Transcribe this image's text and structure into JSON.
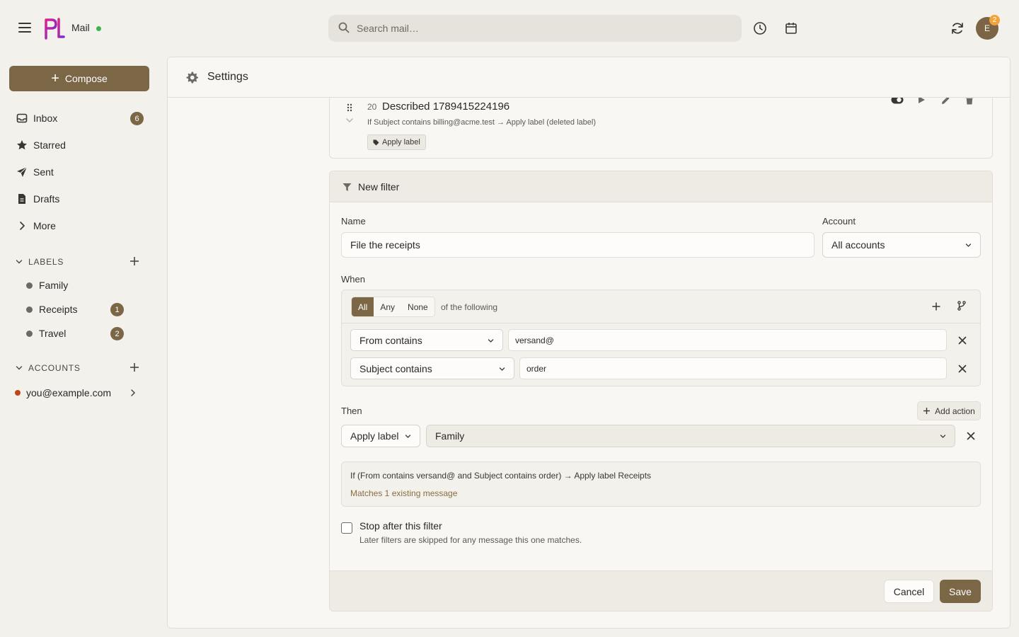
{
  "app": {
    "name": "Mail",
    "status_color": "#3cb44b",
    "accent": "#7b6646"
  },
  "search": {
    "placeholder": "Search mail…"
  },
  "header_icons": [
    "clock-icon",
    "calendar-icon",
    "refresh-icon"
  ],
  "user": {
    "initial": "E",
    "notifications": "2"
  },
  "sidebar": {
    "compose_label": "Compose",
    "nav": [
      {
        "label": "Inbox",
        "icon": "inbox-icon",
        "count": "6"
      },
      {
        "label": "Starred",
        "icon": "star-icon"
      },
      {
        "label": "Sent",
        "icon": "send-icon"
      },
      {
        "label": "Drafts",
        "icon": "draft-icon"
      },
      {
        "label": "More",
        "icon": "chevron-right-icon"
      }
    ],
    "labels_heading": "LABELS",
    "labels": [
      {
        "name": "Family"
      },
      {
        "name": "Receipts",
        "count": "1"
      },
      {
        "name": "Travel",
        "count": "2"
      }
    ],
    "accounts_heading": "ACCOUNTS",
    "accounts": [
      {
        "email": "you@example.com",
        "color": "#c0461a"
      }
    ]
  },
  "settings": {
    "title": "Settings",
    "existing_rule": {
      "number": "20",
      "name": "Described 1789415224196",
      "description": "If Subject contains billing@acme.test → Apply label (deleted label)",
      "tag": "Apply label"
    },
    "new_filter": {
      "title": "New filter",
      "name_label": "Name",
      "name_value": "File the receipts",
      "account_label": "Account",
      "account_value": "All accounts",
      "when_label": "When",
      "match_modes": [
        "All",
        "Any",
        "None"
      ],
      "match_active": "All",
      "match_suffix": "of the following",
      "conditions": [
        {
          "field": "From contains",
          "value": "versand@"
        },
        {
          "field": "Subject contains",
          "value": "order"
        }
      ],
      "then_label": "Then",
      "add_action_label": "Add action",
      "action": {
        "type": "Apply label",
        "label": "Family"
      },
      "summary": "If (From contains versand@ and Subject contains order) → Apply label Receipts",
      "matches": "Matches 1 existing message",
      "stop_label": "Stop after this filter",
      "stop_help": "Later filters are skipped for any message this one matches.",
      "stop_checked": false,
      "cancel_label": "Cancel",
      "save_label": "Save"
    }
  }
}
